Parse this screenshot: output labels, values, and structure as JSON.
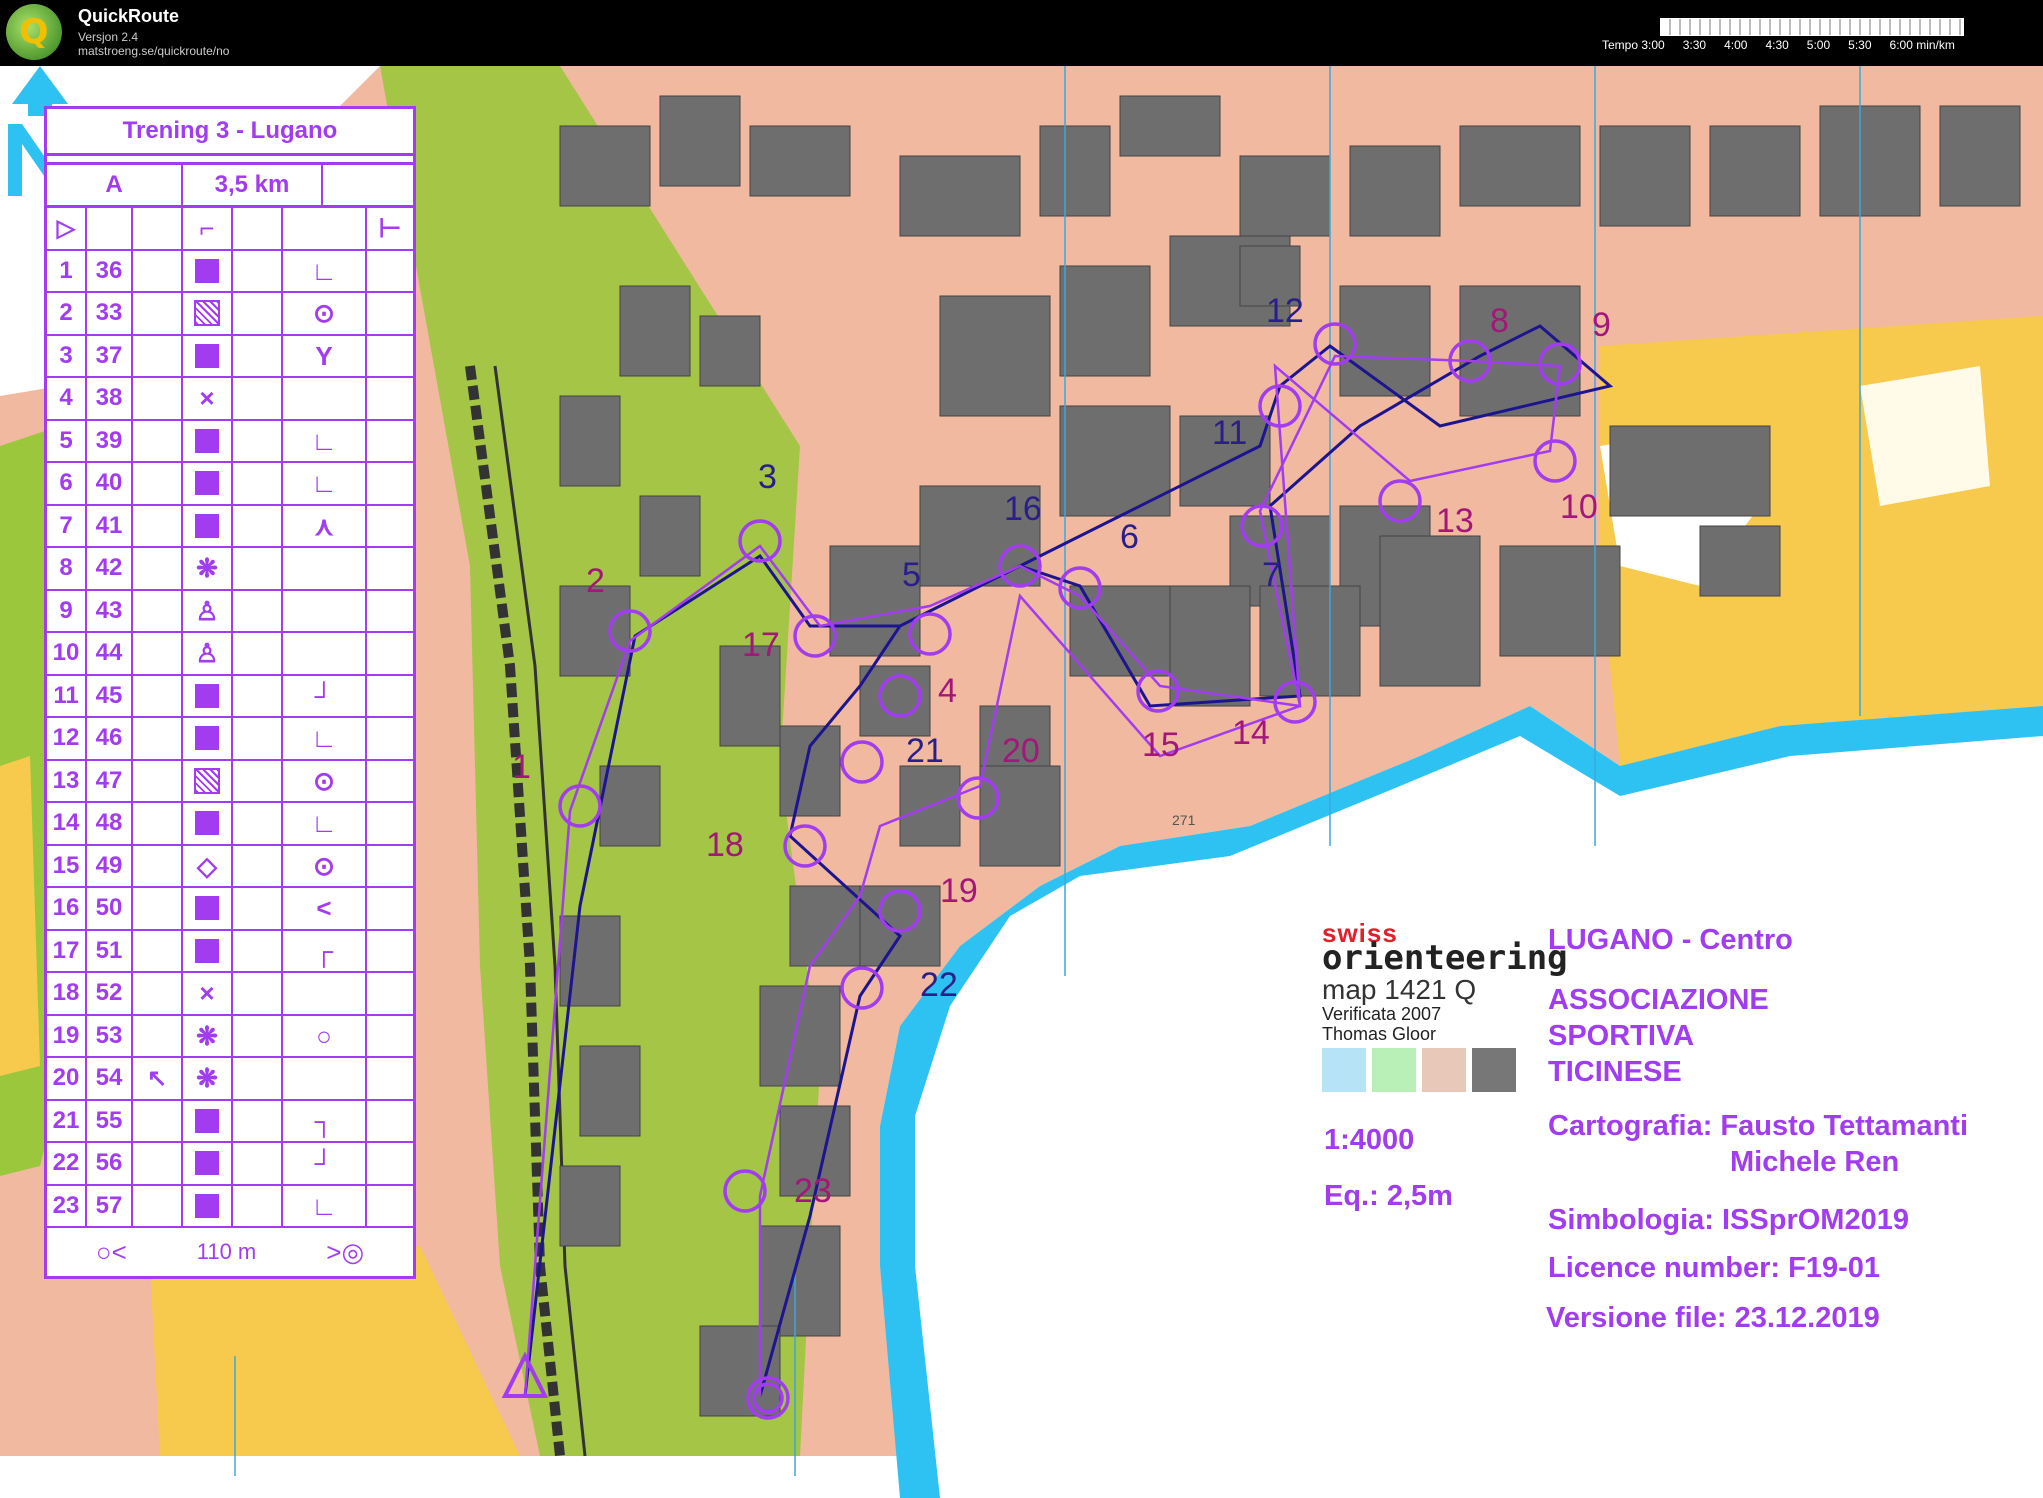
{
  "app": {
    "title": "QuickRoute",
    "version": "Versjon 2.4",
    "url": "matstroeng.se/quickroute/no",
    "logo_letter": "Q",
    "pace_labels": [
      "Tempo 3:00",
      "3:30",
      "4:00",
      "4:30",
      "5:00",
      "5:30",
      "6:00 min/km"
    ]
  },
  "control_description": {
    "title": "Trening 3 - Lugano",
    "class": "A",
    "length": "3,5 km",
    "start_symbol": "▷",
    "rows": [
      {
        "n": "1",
        "code": "36",
        "dir": "",
        "feature": "fill",
        "detail": "∟"
      },
      {
        "n": "2",
        "code": "33",
        "dir": "",
        "feature": "hatch",
        "detail": "⊙"
      },
      {
        "n": "3",
        "code": "37",
        "dir": "",
        "feature": "fill",
        "detail": "Y"
      },
      {
        "n": "4",
        "code": "38",
        "dir": "",
        "feature": "×",
        "detail": ""
      },
      {
        "n": "5",
        "code": "39",
        "dir": "",
        "feature": "fill",
        "detail": "∟"
      },
      {
        "n": "6",
        "code": "40",
        "dir": "",
        "feature": "fill",
        "detail": "∟"
      },
      {
        "n": "7",
        "code": "41",
        "dir": "",
        "feature": "fill",
        "detail": "⋏"
      },
      {
        "n": "8",
        "code": "42",
        "dir": "",
        "feature": "❋",
        "detail": ""
      },
      {
        "n": "9",
        "code": "43",
        "dir": "",
        "feature": "♙",
        "detail": ""
      },
      {
        "n": "10",
        "code": "44",
        "dir": "",
        "feature": "♙",
        "detail": ""
      },
      {
        "n": "11",
        "code": "45",
        "dir": "",
        "feature": "fill",
        "detail": "┘"
      },
      {
        "n": "12",
        "code": "46",
        "dir": "",
        "feature": "fill",
        "detail": "∟"
      },
      {
        "n": "13",
        "code": "47",
        "dir": "",
        "feature": "hatch",
        "detail": "⊙"
      },
      {
        "n": "14",
        "code": "48",
        "dir": "",
        "feature": "fill",
        "detail": "∟"
      },
      {
        "n": "15",
        "code": "49",
        "dir": "",
        "feature": "◇",
        "detail": "⊙"
      },
      {
        "n": "16",
        "code": "50",
        "dir": "",
        "feature": "fill",
        "detail": "<"
      },
      {
        "n": "17",
        "code": "51",
        "dir": "",
        "feature": "fill",
        "detail": "┌"
      },
      {
        "n": "18",
        "code": "52",
        "dir": "",
        "feature": "×",
        "detail": ""
      },
      {
        "n": "19",
        "code": "53",
        "dir": "",
        "feature": "❋",
        "detail": "○"
      },
      {
        "n": "20",
        "code": "54",
        "dir": "↖",
        "feature": "❋",
        "detail": ""
      },
      {
        "n": "21",
        "code": "55",
        "dir": "",
        "feature": "fill",
        "detail": "┐"
      },
      {
        "n": "22",
        "code": "56",
        "dir": "",
        "feature": "fill",
        "detail": "┘"
      },
      {
        "n": "23",
        "code": "57",
        "dir": "",
        "feature": "fill",
        "detail": "∟"
      }
    ],
    "finish_text": "110 m"
  },
  "map_info": {
    "place": "LUGANO - Centro",
    "club_line1": "ASSOCIAZIONE",
    "club_line2": "SPORTIVA",
    "club_line3": "TICINESE",
    "cartography": "Cartografia: Fausto Tettamanti",
    "cartography2": "Michele Ren",
    "symbology": "Simbologia: ISSprOM2019",
    "licence": "Licence number: F19-01",
    "version_file": "Versione file: 23.12.2019",
    "scale": "1:4000",
    "equidistance": "Eq.: 2,5m",
    "swiss_line1": "swiss",
    "swiss_line2": "orienteering",
    "swiss_line3": "map 1421 Q",
    "verified": "Verificata 2007",
    "verifier": "Thomas Gloor",
    "height_label": "271"
  },
  "controls": [
    {
      "label": "1",
      "color": "red"
    },
    {
      "label": "2",
      "color": "red"
    },
    {
      "label": "3",
      "color": "blue"
    },
    {
      "label": "4",
      "color": "red"
    },
    {
      "label": "5",
      "color": "blue"
    },
    {
      "label": "6",
      "color": "blue"
    },
    {
      "label": "7",
      "color": "blue"
    },
    {
      "label": "8",
      "color": "red"
    },
    {
      "label": "9",
      "color": "red"
    },
    {
      "label": "10",
      "color": "red"
    },
    {
      "label": "11",
      "color": "blue"
    },
    {
      "label": "12",
      "color": "blue"
    },
    {
      "label": "13",
      "color": "red"
    },
    {
      "label": "14",
      "color": "red"
    },
    {
      "label": "15",
      "color": "red"
    },
    {
      "label": "16",
      "color": "blue"
    },
    {
      "label": "17",
      "color": "red"
    },
    {
      "label": "18",
      "color": "red"
    },
    {
      "label": "19",
      "color": "red"
    },
    {
      "label": "20",
      "color": "red"
    },
    {
      "label": "21",
      "color": "blue"
    },
    {
      "label": "22",
      "color": "blue"
    },
    {
      "label": "23",
      "color": "red"
    }
  ],
  "colors": {
    "course": "#a23cf0",
    "route": "#1d1490",
    "water": "#2ec2f2",
    "street": "#f1b9a0",
    "building": "#6e6e6e",
    "forest": "#9bc73c",
    "open": "#f7c94c"
  }
}
